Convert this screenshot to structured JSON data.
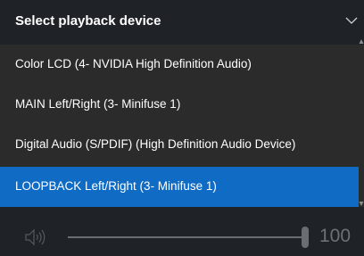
{
  "header": {
    "title": "Select playback device",
    "chevron_icon": "chevron-down-icon"
  },
  "devices": [
    {
      "label": "Color LCD (4- NVIDIA High Definition Audio)",
      "selected": false
    },
    {
      "label": "MAIN Left/Right (3- Minifuse 1)",
      "selected": false
    },
    {
      "label": "Digital Audio (S/PDIF) (High Definition Audio Device)",
      "selected": false
    },
    {
      "label": "LOOPBACK Left/Right (3- Minifuse 1)",
      "selected": true
    }
  ],
  "volume": {
    "icon": "speaker-icon",
    "level": 100,
    "value_text": "100"
  },
  "colors": {
    "accent": "#0f6bc4",
    "background": "#1f2327",
    "list_background": "#2b2b2b",
    "disabled_text": "#6d7175"
  }
}
